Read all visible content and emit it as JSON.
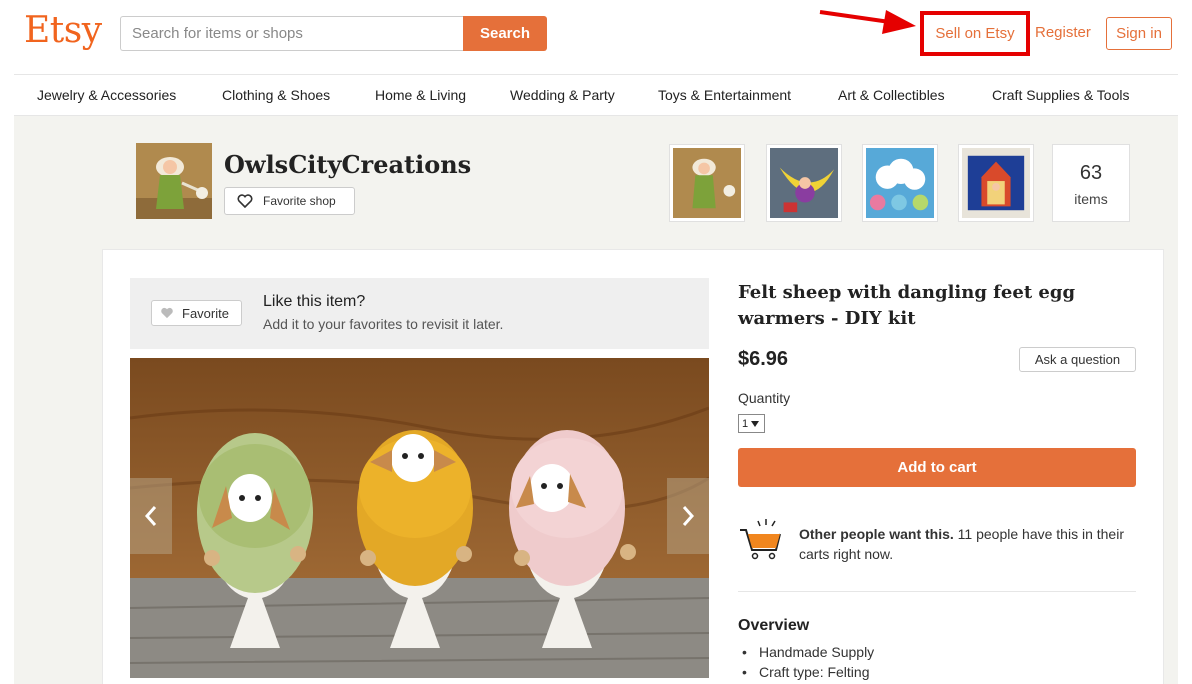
{
  "header": {
    "logo": "Etsy",
    "search_placeholder": "Search for items or shops",
    "search_button": "Search",
    "sell_link": "Sell on Etsy",
    "register_link": "Register",
    "signin_button": "Sign in"
  },
  "categories": [
    "Jewelry & Accessories",
    "Clothing & Shoes",
    "Home & Living",
    "Wedding & Party",
    "Toys & Entertainment",
    "Art & Collectibles",
    "Craft Supplies & Tools"
  ],
  "shop": {
    "name": "OwlsCityCreations",
    "favorite_button": "Favorite shop",
    "items_count": "63",
    "items_label": "items"
  },
  "favorite_banner": {
    "button": "Favorite",
    "title": "Like this item?",
    "subtitle": "Add it to your favorites to revisit it later."
  },
  "listing": {
    "title": "Felt sheep with dangling feet egg warmers - DIY kit",
    "price": "$6.96",
    "ask_button": "Ask a question",
    "quantity_label": "Quantity",
    "quantity_value": "1",
    "add_to_cart": "Add to cart",
    "demand_bold": "Other people want this.",
    "demand_text": " 11 people have this in their carts right now.",
    "overview_title": "Overview",
    "overview_items": [
      "Handmade Supply",
      "Craft type: Felting"
    ]
  },
  "colors": {
    "brand_orange": "#F1641E",
    "button_orange": "#E5703A",
    "highlight_red": "#E50000",
    "page_bg": "#F3F3EF"
  },
  "icons": {
    "favorite_shop": "heart-outline-icon",
    "favorite": "heart-filled-icon",
    "prev": "chevron-left-icon",
    "next": "chevron-right-icon",
    "cart": "shopping-cart-icon"
  }
}
